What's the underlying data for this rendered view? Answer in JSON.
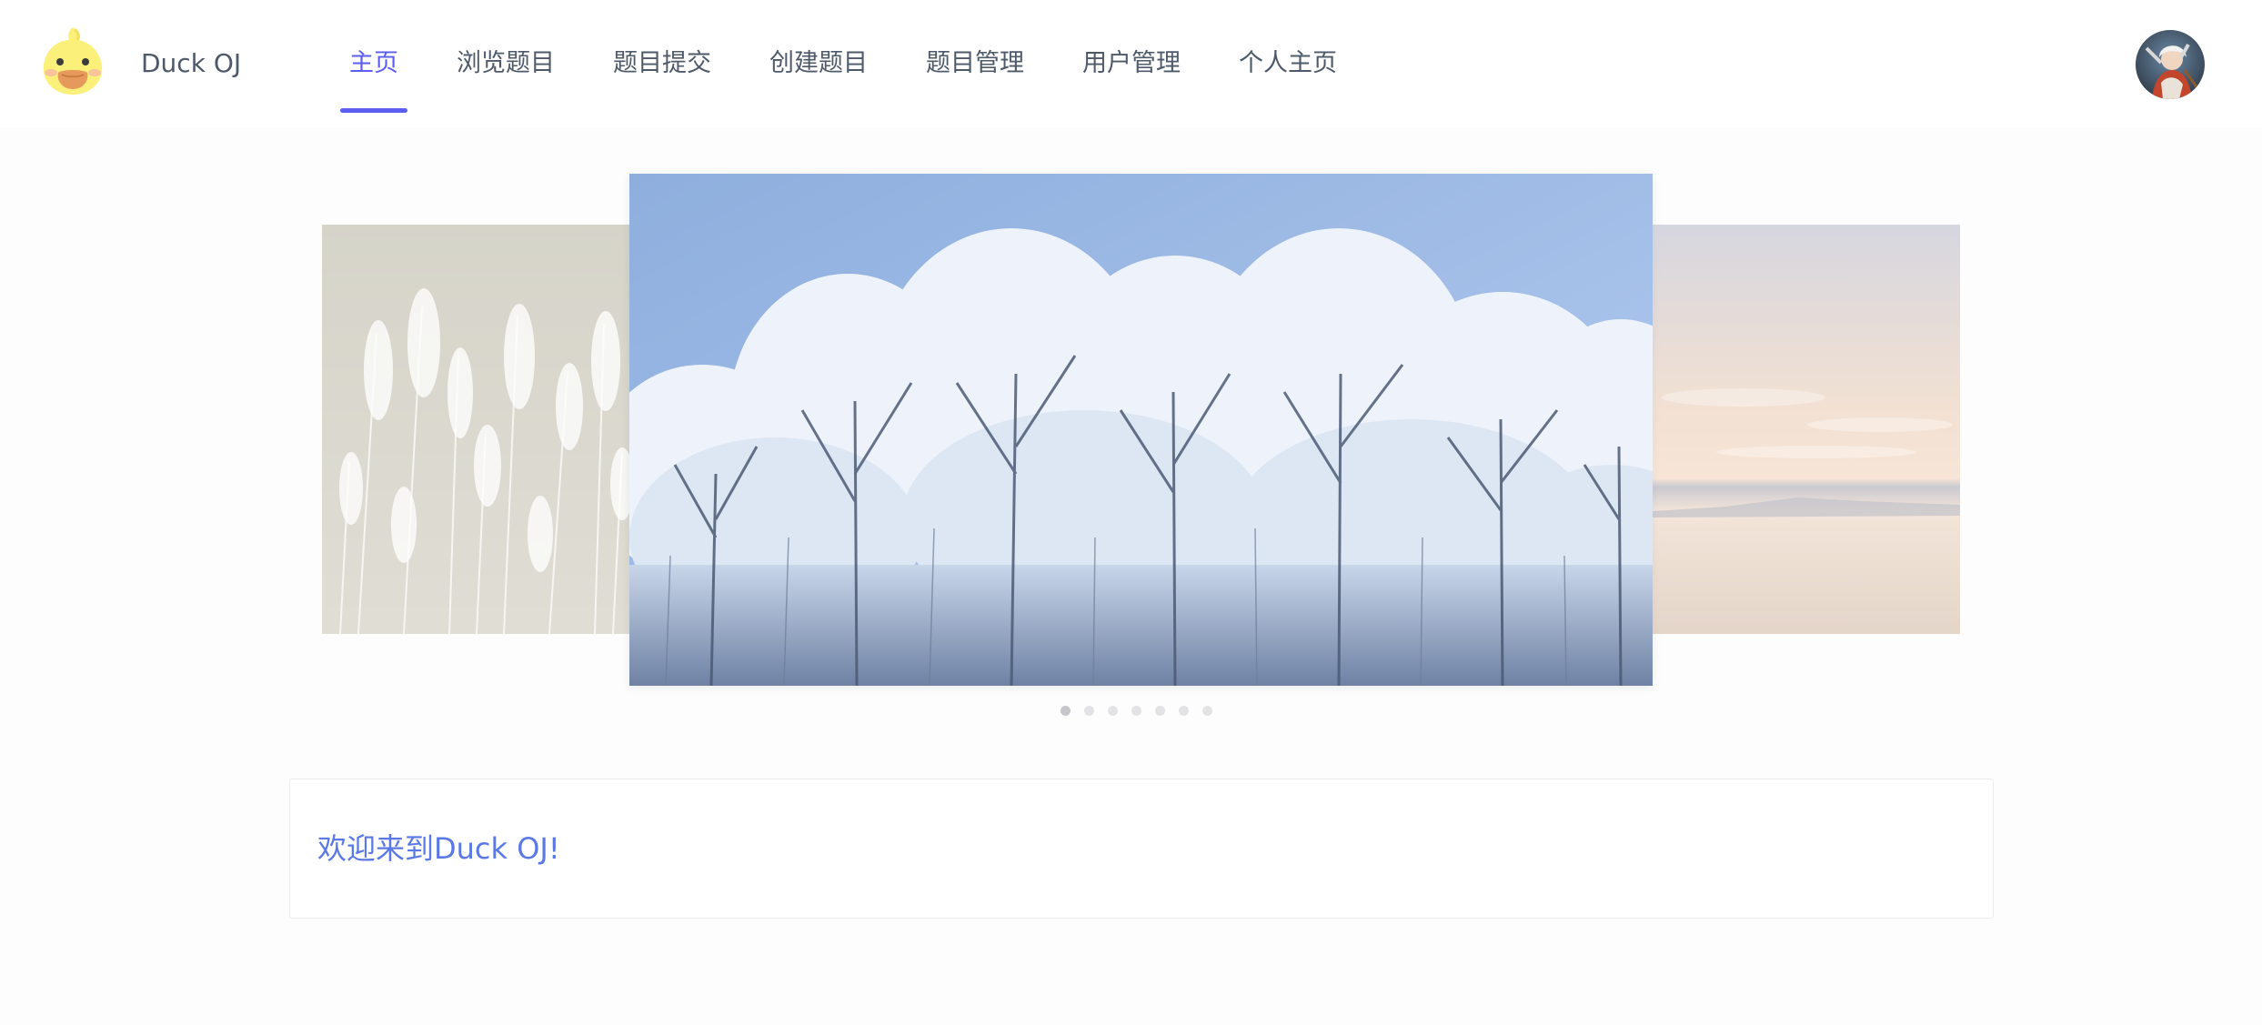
{
  "app": {
    "name": "Duck OJ",
    "logo_icon": "duck-logo-icon",
    "accent_color": "#5b5ef0"
  },
  "nav": {
    "items": [
      {
        "label": "主页",
        "active": true
      },
      {
        "label": "浏览题目",
        "active": false
      },
      {
        "label": "题目提交",
        "active": false
      },
      {
        "label": "创建题目",
        "active": false
      },
      {
        "label": "题目管理",
        "active": false
      },
      {
        "label": "用户管理",
        "active": false
      },
      {
        "label": "个人主页",
        "active": false
      }
    ]
  },
  "user": {
    "avatar_icon": "user-avatar"
  },
  "carousel": {
    "slides": [
      {
        "name": "reeds",
        "position": "previous"
      },
      {
        "name": "frosted-trees",
        "position": "current"
      },
      {
        "name": "lake-sunset",
        "position": "next"
      }
    ],
    "dot_count": 7,
    "active_index": 0
  },
  "welcome": {
    "text": "欢迎来到Duck OJ!",
    "color": "#5a78e6"
  }
}
